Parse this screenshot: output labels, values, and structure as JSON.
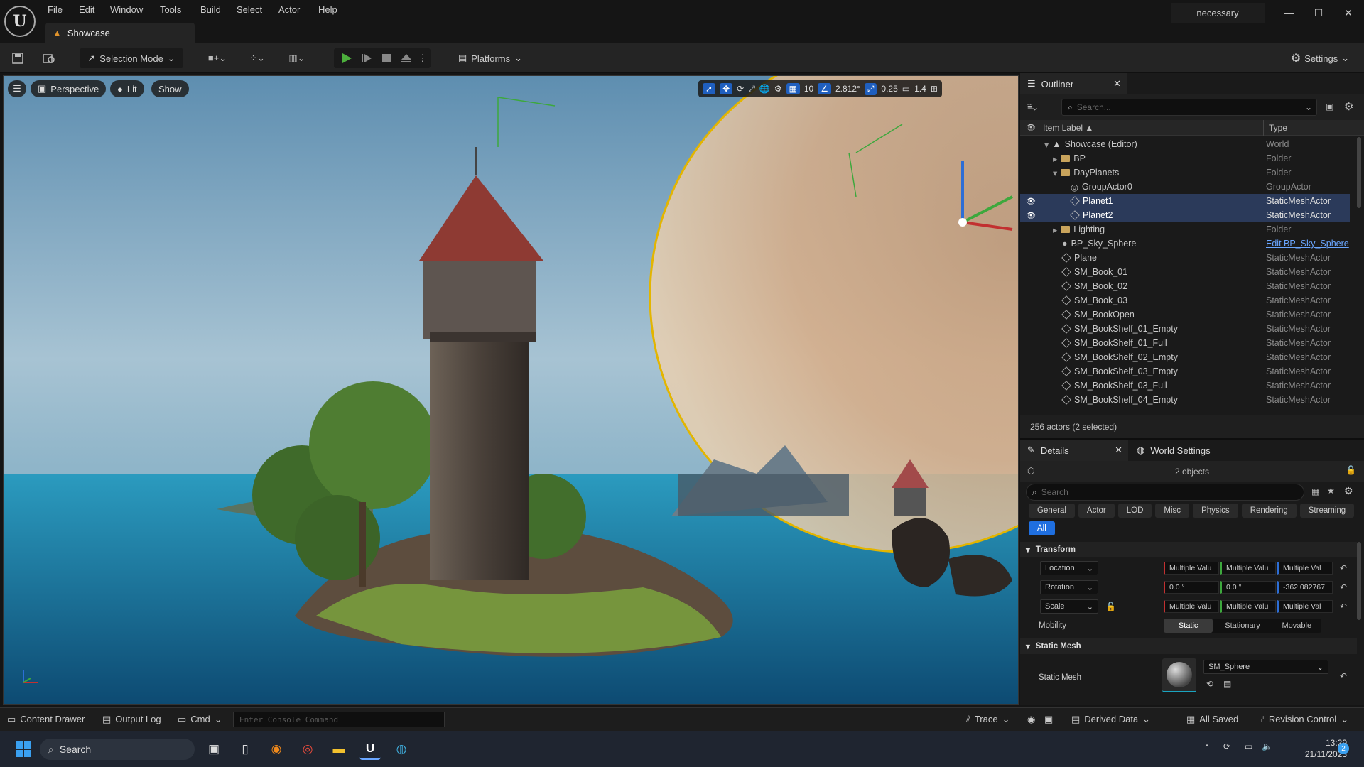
{
  "titlebar": {
    "menu": [
      "File",
      "Edit",
      "Window",
      "Tools",
      "Build",
      "Select",
      "Actor",
      "Help"
    ],
    "document_tab": "Showcase",
    "project_name": "necessary",
    "window_controls": {
      "minimize": "—",
      "maximize": "☐",
      "close": "✕"
    }
  },
  "toolbar": {
    "selection_mode": "Selection Mode",
    "platforms": "Platforms",
    "settings": "Settings"
  },
  "viewport": {
    "view_mode": "Perspective",
    "lighting_mode": "Lit",
    "show_label": "Show",
    "grid_snap": "10",
    "rotation_snap": "2.812°",
    "scale_snap": "0.25",
    "camera_speed": "1.4"
  },
  "outliner": {
    "title": "Outliner",
    "search_placeholder": "Search...",
    "col_label": "Item Label ▲",
    "col_type": "Type",
    "rows": [
      {
        "label": "Showcase (Editor)",
        "type": "World",
        "icon": "world-icon",
        "indent": 1,
        "expanded": true,
        "selected": false,
        "visible": false
      },
      {
        "label": "BP",
        "type": "Folder",
        "icon": "folder-icon",
        "indent": 2,
        "expanded": false,
        "selected": false,
        "visible": false
      },
      {
        "label": "DayPlanets",
        "type": "Folder",
        "icon": "folder-icon",
        "indent": 2,
        "expanded": true,
        "selected": false,
        "visible": false
      },
      {
        "label": "GroupActor0",
        "type": "GroupActor",
        "icon": "group-icon",
        "indent": 3,
        "selected": false,
        "visible": false
      },
      {
        "label": "Planet1",
        "type": "StaticMeshActor",
        "icon": "mesh-icon",
        "indent": 3,
        "selected": true,
        "visible": true
      },
      {
        "label": "Planet2",
        "type": "StaticMeshActor",
        "icon": "mesh-icon",
        "indent": 3,
        "selected": true,
        "visible": true
      },
      {
        "label": "Lighting",
        "type": "Folder",
        "icon": "folder-icon",
        "indent": 2,
        "expanded": false,
        "selected": false,
        "visible": false
      },
      {
        "label": "BP_Sky_Sphere",
        "type": "Edit BP_Sky_Sphere",
        "icon": "blueprint-icon",
        "indent": 2,
        "selected": false,
        "visible": false,
        "link": true
      },
      {
        "label": "Plane",
        "type": "StaticMeshActor",
        "icon": "mesh-icon",
        "indent": 2,
        "selected": false,
        "visible": false
      },
      {
        "label": "SM_Book_01",
        "type": "StaticMeshActor",
        "icon": "mesh-icon",
        "indent": 2,
        "selected": false,
        "visible": false
      },
      {
        "label": "SM_Book_02",
        "type": "StaticMeshActor",
        "icon": "mesh-icon",
        "indent": 2,
        "selected": false,
        "visible": false
      },
      {
        "label": "SM_Book_03",
        "type": "StaticMeshActor",
        "icon": "mesh-icon",
        "indent": 2,
        "selected": false,
        "visible": false
      },
      {
        "label": "SM_BookOpen",
        "type": "StaticMeshActor",
        "icon": "mesh-icon",
        "indent": 2,
        "selected": false,
        "visible": false
      },
      {
        "label": "SM_BookShelf_01_Empty",
        "type": "StaticMeshActor",
        "icon": "mesh-icon",
        "indent": 2,
        "selected": false,
        "visible": false
      },
      {
        "label": "SM_BookShelf_01_Full",
        "type": "StaticMeshActor",
        "icon": "mesh-icon",
        "indent": 2,
        "selected": false,
        "visible": false
      },
      {
        "label": "SM_BookShelf_02_Empty",
        "type": "StaticMeshActor",
        "icon": "mesh-icon",
        "indent": 2,
        "selected": false,
        "visible": false
      },
      {
        "label": "SM_BookShelf_03_Empty",
        "type": "StaticMeshActor",
        "icon": "mesh-icon",
        "indent": 2,
        "selected": false,
        "visible": false
      },
      {
        "label": "SM_BookShelf_03_Full",
        "type": "StaticMeshActor",
        "icon": "mesh-icon",
        "indent": 2,
        "selected": false,
        "visible": false
      },
      {
        "label": "SM_BookShelf_04_Empty",
        "type": "StaticMeshActor",
        "icon": "mesh-icon",
        "indent": 2,
        "selected": false,
        "visible": false
      }
    ],
    "footer": "256 actors (2 selected)"
  },
  "details": {
    "tab_details": "Details",
    "tab_world_settings": "World Settings",
    "objects_count": "2 objects",
    "search_placeholder": "Search",
    "filters": [
      "General",
      "Actor",
      "LOD",
      "Misc",
      "Physics",
      "Rendering",
      "Streaming",
      "All"
    ],
    "active_filter": "All",
    "transform": {
      "section": "Transform",
      "location_label": "Location",
      "rotation_label": "Rotation",
      "scale_label": "Scale",
      "location": [
        "Multiple Valu",
        "Multiple Valu",
        "Multiple Val"
      ],
      "rotation": [
        "0.0 °",
        "0.0 °",
        "-362.082767"
      ],
      "scale": [
        "Multiple Valu",
        "Multiple Valu",
        "Multiple Val"
      ],
      "mobility_label": "Mobility",
      "mobility_options": [
        "Static",
        "Stationary",
        "Movable"
      ],
      "mobility_selected": "Static"
    },
    "static_mesh": {
      "section": "Static Mesh",
      "label": "Static Mesh",
      "value": "SM_Sphere"
    }
  },
  "statusbar": {
    "content_drawer": "Content Drawer",
    "output_log": "Output Log",
    "cmd": "Cmd",
    "console_placeholder": "Enter Console Command",
    "trace": "Trace",
    "derived_data": "Derived Data",
    "all_saved": "All Saved",
    "revision_control": "Revision Control"
  },
  "taskbar": {
    "search": "Search",
    "time": "13:29",
    "date": "21/11/2023",
    "notification_count": "2"
  },
  "colors": {
    "accent": "#1f6fe0",
    "selection": "#2b3a5a",
    "background": "#1a1a1a"
  }
}
